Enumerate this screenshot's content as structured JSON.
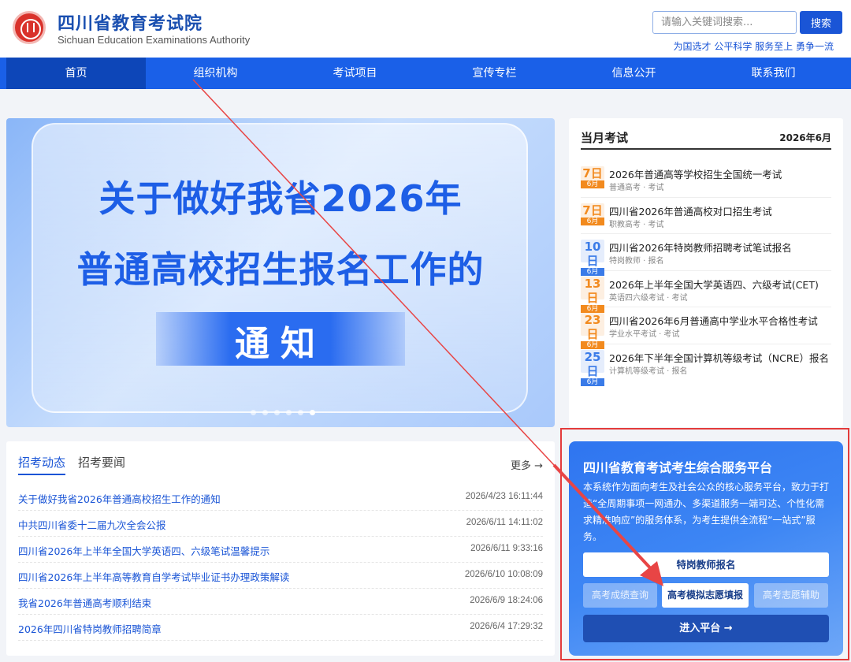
{
  "header": {
    "title": "四川省教育考试院",
    "subtitle": "Sichuan Education Examinations Authority",
    "search_placeholder": "请输入关键词搜索...",
    "search_button": "搜索",
    "slogan": "为国选才 公平科学 服务至上 勇争一流"
  },
  "nav": {
    "items": [
      {
        "label": "首页"
      },
      {
        "label": "组织机构"
      },
      {
        "label": "考试项目"
      },
      {
        "label": "宣传专栏"
      },
      {
        "label": "信息公开"
      },
      {
        "label": "联系我们"
      }
    ]
  },
  "banner": {
    "line1": "关于做好我省2026年",
    "line2": "普通高校招生报名工作的",
    "line3": "通知"
  },
  "monthly": {
    "title": "当月考试",
    "month": "2026年6月",
    "exams": [
      {
        "day": "7日",
        "month": "6月",
        "title": "2026年普通高等学校招生全国统一考试",
        "sub": "普通高考 · 考试",
        "color": "#f28a1e"
      },
      {
        "day": "7日",
        "month": "6月",
        "title": "四川省2026年普通高校对口招生考试",
        "sub": "职教高考 · 考试",
        "color": "#f28a1e"
      },
      {
        "day": "10日",
        "month": "6月",
        "title": "四川省2026年特岗教师招聘考试笔试报名",
        "sub": "特岗教师 · 报名",
        "color": "#3a7be8"
      },
      {
        "day": "13日",
        "month": "6月",
        "title": "2026年上半年全国大学英语四、六级考试(CET)",
        "sub": "英语四六级考试 · 考试",
        "color": "#f28a1e"
      },
      {
        "day": "23日",
        "month": "6月",
        "title": "四川省2026年6月普通高中学业水平合格性考试",
        "sub": "学业水平考试 · 考试",
        "color": "#f28a1e"
      },
      {
        "day": "25日",
        "month": "6月",
        "title": "2026年下半年全国计算机等级考试（NCRE）报名",
        "sub": "计算机等级考试 · 报名",
        "color": "#3a7be8"
      }
    ]
  },
  "news": {
    "tab_active": "招考动态",
    "tab_inactive": "招考要闻",
    "more": "更多 →",
    "items": [
      {
        "title": "关于做好我省2026年普通高校招生工作的通知",
        "date": "2026/4/23 16:11:44"
      },
      {
        "title": "中共四川省委十二届九次全会公报",
        "date": "2026/6/11 14:11:02"
      },
      {
        "title": "四川省2026年上半年全国大学英语四、六级笔试温馨提示",
        "date": "2026/6/11 9:33:16"
      },
      {
        "title": "四川省2026年上半年高等教育自学考试毕业证书办理政策解读",
        "date": "2026/6/10 10:08:09"
      },
      {
        "title": "我省2026年普通高考顺利结束",
        "date": "2026/6/9 18:24:06"
      },
      {
        "title": "2026年四川省特岗教师招聘简章",
        "date": "2026/6/4 17:29:32"
      }
    ]
  },
  "platform": {
    "title": "四川省教育考试考生综合服务平台",
    "description": "本系统作为面向考生及社会公众的核心服务平台，致力于打造“全周期事项一网通办、多渠道服务一端可达、个性化需求精准响应”的服务体系，为考生提供全流程“一站式”服务。",
    "btn_teacher": "特岗教师报名",
    "btn_score": "高考成绩查询",
    "btn_mock": "高考模拟志愿填报",
    "btn_assist": "高考志愿辅助",
    "btn_enter": "进入平台 →"
  },
  "colors": {
    "brand": "#1a60e8",
    "highlight_border": "#e33b3b",
    "arrow": "#e84545"
  }
}
